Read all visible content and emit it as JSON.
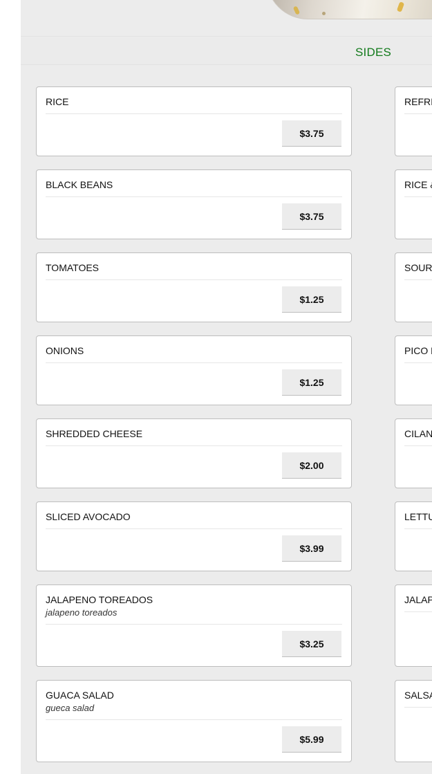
{
  "section": {
    "title": "SIDES"
  },
  "left_items": [
    {
      "name": "RICE",
      "description": "",
      "price": "$3.75"
    },
    {
      "name": "BLACK BEANS",
      "description": "",
      "price": "$3.75"
    },
    {
      "name": "TOMATOES",
      "description": "",
      "price": "$1.25"
    },
    {
      "name": "ONIONS",
      "description": "",
      "price": "$1.25"
    },
    {
      "name": "SHREDDED CHEESE",
      "description": "",
      "price": "$2.00"
    },
    {
      "name": "SLICED AVOCADO",
      "description": "",
      "price": "$3.99"
    },
    {
      "name": "JALAPENO TOREADOS",
      "description": "jalapeno toreados",
      "price": "$3.25"
    },
    {
      "name": "GUACA SALAD",
      "description": "gueca salad",
      "price": "$5.99"
    }
  ],
  "right_items_partial": [
    {
      "name": "REFRI"
    },
    {
      "name": "RICE &"
    },
    {
      "name": "SOUR"
    },
    {
      "name": "PICO D"
    },
    {
      "name": "CILAN"
    },
    {
      "name": "LETTU"
    },
    {
      "name": "JALAP"
    },
    {
      "name": "SALSA"
    }
  ]
}
